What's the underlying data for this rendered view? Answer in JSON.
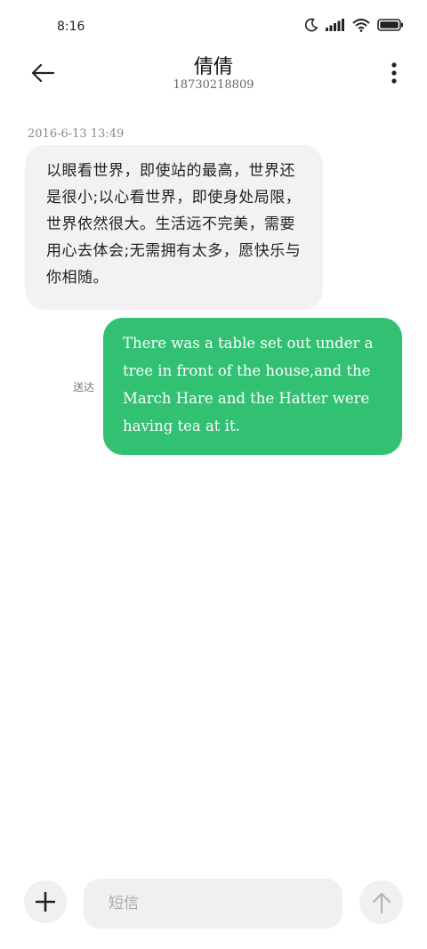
{
  "status_bar": {
    "time": "8:16",
    "icons": [
      "moon-icon",
      "cellular-signal-icon",
      "wifi-icon",
      "battery-icon"
    ]
  },
  "header": {
    "contact_name": "倩倩",
    "contact_number": "18730218809",
    "icons": [
      "back-arrow-icon",
      "more-vertical-icon"
    ]
  },
  "conversation": {
    "timestamp": "2016-6-13 13:49",
    "messages": [
      {
        "direction": "incoming",
        "text": "以眼看世界，即使站的最高，世界还是很小;以心看世界，即使身处局限，世界依然很大。生活远不完美，需要用心去体会;无需拥有太多，愿快乐与你相随。"
      },
      {
        "direction": "outgoing",
        "text": "There was a table set out under a tree in front of the house,and the March Hare and the Hatter were having tea at it.",
        "status": "送达"
      }
    ]
  },
  "composer": {
    "placeholder": "短信",
    "value": "",
    "icons": [
      "plus-icon",
      "send-arrow-icon"
    ]
  },
  "colors": {
    "outgoing_bubble": "#32c072",
    "incoming_bubble": "#f2f2f2",
    "background": "#ffffff"
  }
}
